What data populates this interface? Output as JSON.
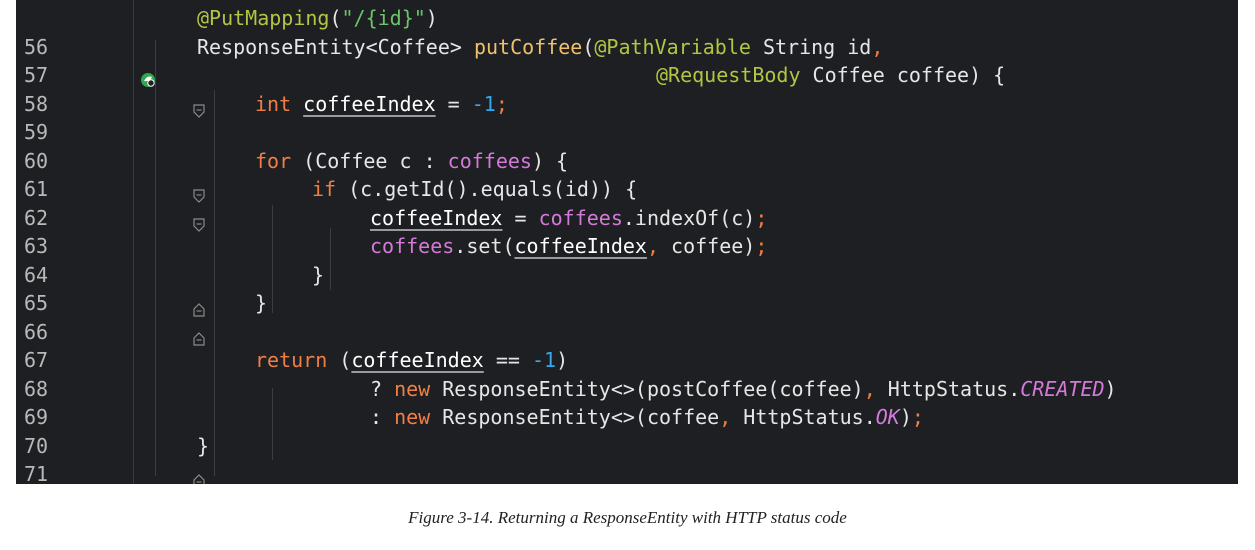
{
  "code_lines": [
    {
      "n": "56",
      "text": "@PutMapping(\"/{id}\")"
    },
    {
      "n": "57",
      "text": "ResponseEntity<Coffee> putCoffee(@PathVariable String id,"
    },
    {
      "n": "58",
      "text": "@RequestBody Coffee coffee) {"
    },
    {
      "n": "59",
      "text": "int coffeeIndex = -1;"
    },
    {
      "n": "60",
      "text": ""
    },
    {
      "n": "61",
      "text": "for (Coffee c : coffees) {"
    },
    {
      "n": "62",
      "text": "if (c.getId().equals(id)) {"
    },
    {
      "n": "63",
      "text": "coffeeIndex = coffees.indexOf(c);"
    },
    {
      "n": "64",
      "text": "coffees.set(coffeeIndex, coffee);"
    },
    {
      "n": "65",
      "text": "}"
    },
    {
      "n": "66",
      "text": "}"
    },
    {
      "n": "67",
      "text": ""
    },
    {
      "n": "68",
      "text": "return (coffeeIndex == -1)"
    },
    {
      "n": "69",
      "text": "? new ResponseEntity<>(postCoffee(coffee), HttpStatus.CREATED)"
    },
    {
      "n": "70",
      "text": ": new ResponseEntity<>(coffee, HttpStatus.OK);"
    },
    {
      "n": "71",
      "text": "}"
    }
  ],
  "gutter_icons": {
    "57": "bean-mapping-icon",
    "58": "fold-open-icon",
    "61": "fold-open-icon",
    "62": "fold-open-icon",
    "65": "fold-close-icon",
    "66": "fold-close-icon",
    "71": "fold-close-icon"
  },
  "theme": {
    "background": "#1e1f22",
    "keyword": "#f07f45",
    "annotation": "#b3c542",
    "string": "#6ac56b",
    "method": "#f0c06a",
    "field": "#d37ad8",
    "number": "#35a8f0"
  },
  "caption": "Figure 3-14. Returning a ResponseEntity with HTTP status code"
}
